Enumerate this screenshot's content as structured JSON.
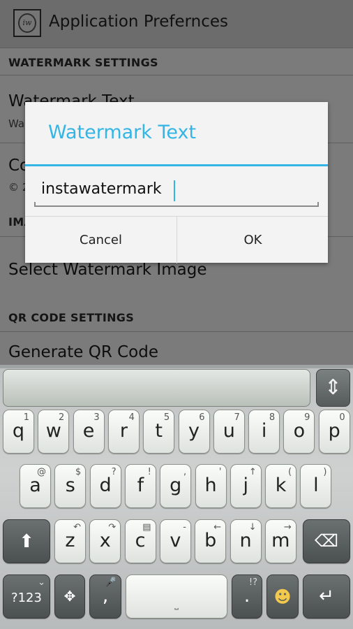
{
  "app_bar": {
    "title": "Application Prefernces",
    "icon": "app-logo-icon",
    "icon_text": "iw"
  },
  "preferences": {
    "watermark_category": "WATERMARK SETTINGS",
    "watermark_text_title": "Watermark Text",
    "watermark_text_summary": "Wa",
    "copyright_title": "Co",
    "copyright_summary": "© 2",
    "image_category": "IMA",
    "select_image_title": "Select Watermark Image",
    "qr_category": "QR CODE SETTINGS",
    "qr_generate_title": "Generate QR Code"
  },
  "dialog": {
    "title": "Watermark Text",
    "input_value": "instawatermark",
    "cancel_label": "Cancel",
    "ok_label": "OK",
    "accent_color": "#33b5e5"
  },
  "keyboard": {
    "row1": [
      {
        "m": "q",
        "h": "1"
      },
      {
        "m": "w",
        "h": "2"
      },
      {
        "m": "e",
        "h": "3"
      },
      {
        "m": "r",
        "h": "4"
      },
      {
        "m": "t",
        "h": "5"
      },
      {
        "m": "y",
        "h": "6"
      },
      {
        "m": "u",
        "h": "7"
      },
      {
        "m": "i",
        "h": "8"
      },
      {
        "m": "o",
        "h": "9"
      },
      {
        "m": "p",
        "h": "0"
      }
    ],
    "row2": [
      {
        "m": "a",
        "h": "@"
      },
      {
        "m": "s",
        "h": "$"
      },
      {
        "m": "d",
        "h": "?"
      },
      {
        "m": "f",
        "h": "!"
      },
      {
        "m": "g",
        "h": ","
      },
      {
        "m": "h",
        "h": "'"
      },
      {
        "m": "j",
        "h": "↑"
      },
      {
        "m": "k",
        "h": "("
      },
      {
        "m": "l",
        "h": ")"
      }
    ],
    "row3": [
      {
        "m": "z",
        "h": "↶"
      },
      {
        "m": "x",
        "h": "↷"
      },
      {
        "m": "c",
        "h": "▤"
      },
      {
        "m": "v",
        "h": "-"
      },
      {
        "m": "b",
        "h": "←"
      },
      {
        "m": "n",
        "h": "↓"
      },
      {
        "m": "m",
        "h": "→"
      }
    ],
    "symbols_label": "?123",
    "comma": ",",
    "period": ".",
    "period_hint": "!?",
    "shift_icon": "shift-icon",
    "delete_icon": "backspace-icon",
    "enter_icon": "enter-icon",
    "emoji_icon": "emoji-icon",
    "mic_icon": "microphone-icon",
    "move_icon": "move-arrows-icon"
  }
}
